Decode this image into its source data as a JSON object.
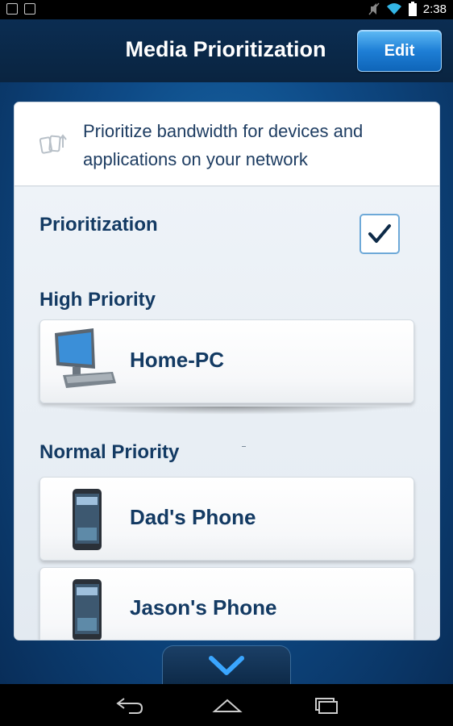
{
  "status_bar": {
    "time": "2:38",
    "left_icons": [
      "notification-1-icon",
      "image-notification-icon"
    ],
    "right_icons": [
      "mute-icon",
      "wifi-icon",
      "battery-icon"
    ]
  },
  "header": {
    "title": "Media Prioritization",
    "edit_label": "Edit"
  },
  "intro": {
    "icon": "prioritize-icon",
    "text": "Prioritize bandwidth for devices and applications on your network"
  },
  "prioritization": {
    "label": "Prioritization",
    "checked": true
  },
  "sections": {
    "high": {
      "title": "High Priority",
      "devices": [
        {
          "name": "Home-PC",
          "icon": "desktop-computer-icon"
        }
      ]
    },
    "normal": {
      "title": "Normal Priority",
      "devices": [
        {
          "name": "Dad's Phone",
          "icon": "smartphone-icon"
        },
        {
          "name": "Jason's Phone",
          "icon": "smartphone-icon"
        }
      ]
    }
  },
  "bottom_tab": {
    "icon": "chevron-down-icon"
  },
  "nav_bar": {
    "buttons": [
      "back-icon",
      "home-icon",
      "recent-apps-icon"
    ]
  },
  "colors": {
    "accent": "#1e7fd6",
    "heading_text": "#133a63",
    "header_bg": "#0b2d52"
  }
}
